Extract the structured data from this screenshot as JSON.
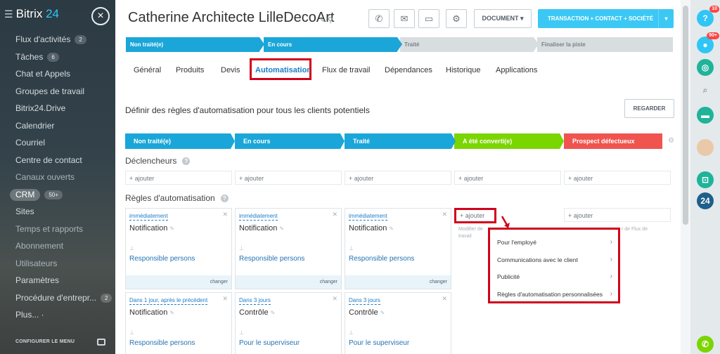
{
  "sidebar": {
    "brand_name": "Bitrix",
    "brand_num": "24",
    "close_icon": "×",
    "items": [
      {
        "label": "Flux d'activités",
        "count": "2"
      },
      {
        "label": "Tâches",
        "count": "6"
      },
      {
        "label": "Chat et Appels",
        "count": ""
      },
      {
        "label": "Groupes de travail",
        "count": ""
      },
      {
        "label": "Bitrix24.Drive",
        "count": ""
      },
      {
        "label": "Calendrier",
        "count": ""
      },
      {
        "label": "Courriel",
        "count": ""
      },
      {
        "label": "Centre de contact",
        "count": ""
      },
      {
        "label": "Canaux ouverts",
        "count": ""
      },
      {
        "label": "CRM",
        "count": "50+"
      },
      {
        "label": "Sites",
        "count": ""
      },
      {
        "label": "Temps et rapports",
        "count": ""
      },
      {
        "label": "Abonnement",
        "count": ""
      },
      {
        "label": "Utilisateurs",
        "count": ""
      },
      {
        "label": "Paramètres",
        "count": ""
      },
      {
        "label": "Procédure d'entrepr...",
        "count": "2"
      },
      {
        "label": "Plus... ·",
        "count": ""
      }
    ],
    "config_label": "CONFIGURER LE MENU"
  },
  "header": {
    "title": "Catherine Architecte LilleDecoArt",
    "document_label": "DOCUMENT",
    "main_action_label": "TRANSACTION + CONTACT + SOCIÉTÉ"
  },
  "stage_bar": [
    "Non traité(e)",
    "En cours",
    "Traité",
    "Finaliser la piste"
  ],
  "tabs": [
    "Général",
    "Produits",
    "Devis",
    "Automatisation",
    "Flux de travail",
    "Dépendances",
    "Historique",
    "Applications"
  ],
  "active_tab": "Automatisation",
  "automation": {
    "description": "Définir des règles d'automatisation pour tous les clients potentiels",
    "watch_label": "REGARDER",
    "columns": [
      {
        "label": "Non traité(e)",
        "color": "#1aa6d8"
      },
      {
        "label": "En cours",
        "color": "#1aa6d8"
      },
      {
        "label": "Traité",
        "color": "#1aa6d8"
      },
      {
        "label": "A été converti(e)",
        "color": "#7bd500"
      },
      {
        "label": "Prospect défectueux",
        "color": "#f0544e"
      }
    ],
    "triggers_title": "Déclencheurs",
    "rules_title": "Règles d'automatisation",
    "add_label": "+ ajouter",
    "cards_row1": [
      {
        "when": "immédiatement",
        "name": "Notification",
        "who": "Responsible persons",
        "footer": "changer"
      },
      {
        "when": "immédiatement",
        "name": "Notification",
        "who": "Responsible persons",
        "footer": "changer"
      },
      {
        "when": "immédiatement",
        "name": "Notification",
        "who": "Responsible persons",
        "footer": "changer"
      }
    ],
    "cards_row2": [
      {
        "when": "Dans 1 jour, après le précédent",
        "name": "Notification",
        "who": "Responsible persons"
      },
      {
        "when": "Dans 3 jours",
        "name": "Contrôle",
        "who": "Pour le superviseur"
      },
      {
        "when": "Dans 3 jours",
        "name": "Contrôle",
        "who": "Pour le superviseur"
      }
    ],
    "hidden_hint_left": "Modifier de\ntravail",
    "hidden_hint_right": "r de Flux de"
  },
  "menu": {
    "items": [
      "Pour l'employé",
      "Communications avec le client",
      "Publicité",
      "Règles d'automatisation personnalisées"
    ]
  },
  "rightbar": {
    "help_badge": "10",
    "notif_badge": "90+",
    "b24_label": "24"
  },
  "colors": {
    "accent_blue": "#3bc8f5",
    "stage_blue": "#1aa6d8",
    "highlight_red": "#d0021b",
    "converted_green": "#7bd500",
    "failed_red": "#f0544e"
  }
}
